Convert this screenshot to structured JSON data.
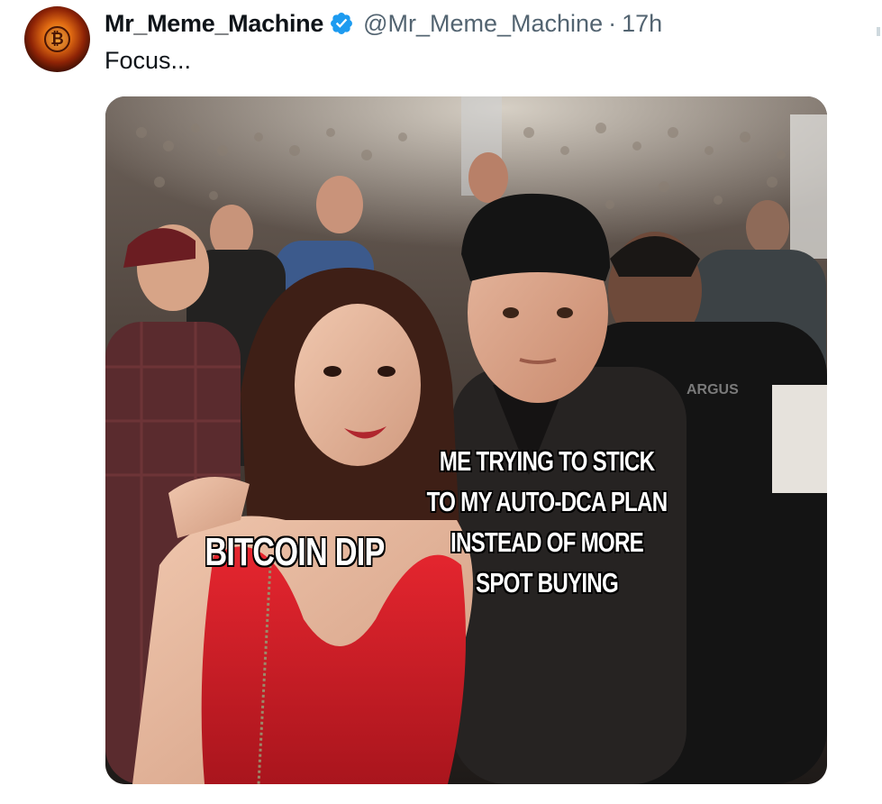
{
  "tweet": {
    "display_name": "Mr_Meme_Machine",
    "verified": true,
    "verified_icon": "verified-badge-icon",
    "handle": "@Mr_Meme_Machine",
    "separator": "·",
    "time": "17h",
    "text": "Focus...",
    "avatar": "bitcoin-fire-avatar"
  },
  "meme": {
    "label_left": "BITCOIN DIP",
    "label_right_lines": [
      "ME TRYING TO STICK",
      "TO MY AUTO-DCA PLAN",
      "INSTEAD OF MORE",
      "SPOT BUYING"
    ],
    "shirt_text": "ARGUS"
  },
  "colors": {
    "verified_blue": "#1d9bf0",
    "secondary_text": "#536471",
    "primary_text": "#0f1419",
    "dress_red": "#d4202a"
  }
}
